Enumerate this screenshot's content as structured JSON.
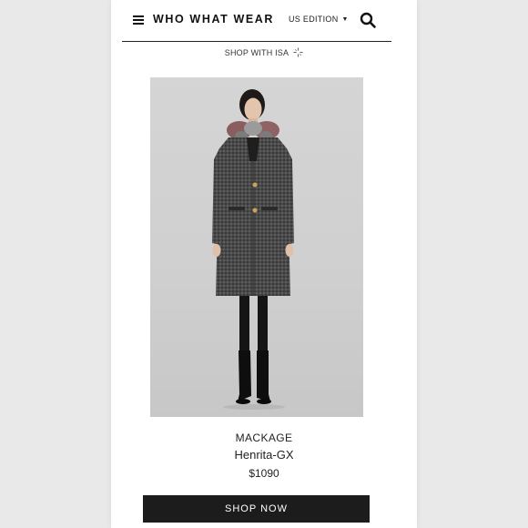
{
  "header": {
    "logo_text": "WHO WHAT WEAR",
    "edition_label": "US EDITION",
    "menu_icon": "hamburger-menu-icon",
    "search_icon": "search-icon",
    "caret_icon": "caret-down-icon"
  },
  "shop_with_isa": {
    "label": "SHOP WITH ISA",
    "icon": "sparkle-icon"
  },
  "product": {
    "brand": "MACKAGE",
    "name": "Henrita-GX",
    "price": "$1090",
    "cta_label": "SHOP NOW"
  },
  "colors": {
    "background": "#e9e9e9",
    "page": "#ffffff",
    "cta": "#1c1c1c",
    "text": "#1a1a1a"
  }
}
